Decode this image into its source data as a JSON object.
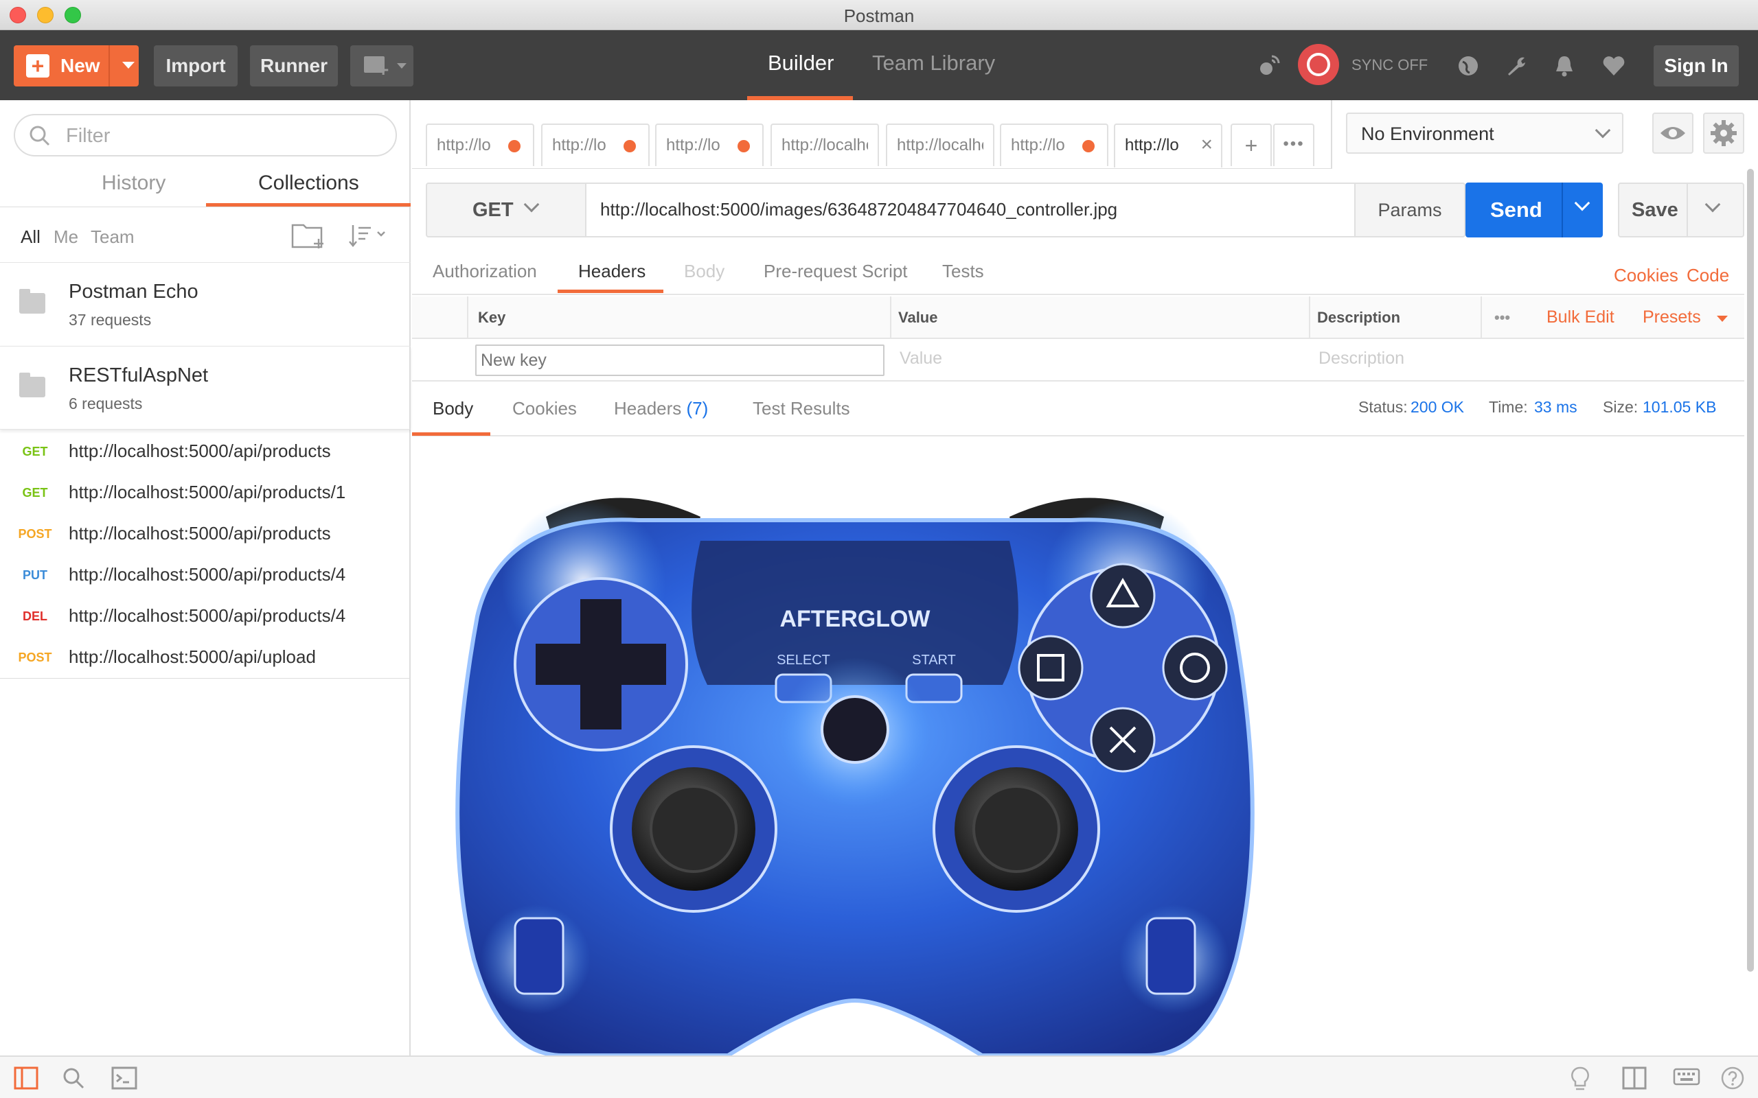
{
  "window": {
    "title": "Postman"
  },
  "header": {
    "new_label": "New",
    "import_label": "Import",
    "runner_label": "Runner",
    "nav": [
      {
        "label": "Builder"
      },
      {
        "label": "Team Library"
      }
    ],
    "sync_text": "SYNC OFF",
    "signin_label": "Sign In",
    "accent": "#f26b3a"
  },
  "sidebar": {
    "filter_placeholder": "Filter",
    "tabs": [
      {
        "label": "History"
      },
      {
        "label": "Collections"
      }
    ],
    "scopes": [
      "All",
      "Me",
      "Team"
    ],
    "collections": [
      {
        "name": "Postman Echo",
        "count": "37 requests"
      },
      {
        "name": "RESTfulAspNet",
        "count": "6 requests"
      }
    ],
    "requests": [
      {
        "method": "GET",
        "color": "#79c314",
        "url": "http://localhost:5000/api/products"
      },
      {
        "method": "GET",
        "color": "#79c314",
        "url": "http://localhost:5000/api/products/1"
      },
      {
        "method": "POST",
        "color": "#f5a623",
        "url": "http://localhost:5000/api/products"
      },
      {
        "method": "PUT",
        "color": "#3a8bd8",
        "url": "http://localhost:5000/api/products/4"
      },
      {
        "method": "DEL",
        "color": "#e0302c",
        "url": "http://localhost:5000/api/products/4"
      },
      {
        "method": "POST",
        "color": "#f5a623",
        "url": "http://localhost:5000/api/upload"
      }
    ]
  },
  "tabs": [
    {
      "label": "http://lo",
      "unsaved": true
    },
    {
      "label": "http://lo",
      "unsaved": true
    },
    {
      "label": "http://lo",
      "unsaved": true
    },
    {
      "label": "http://localho",
      "unsaved": false
    },
    {
      "label": "http://localhos",
      "unsaved": false
    },
    {
      "label": "http://lo",
      "unsaved": true
    },
    {
      "label": "http://lo",
      "unsaved": false,
      "active": true
    }
  ],
  "environment": {
    "selected": "No Environment"
  },
  "request": {
    "method": "GET",
    "url": "http://localhost:5000/images/636487204847704640_controller.jpg",
    "params_label": "Params",
    "send_label": "Send",
    "save_label": "Save",
    "tabs": [
      "Authorization",
      "Headers",
      "Body",
      "Pre-request Script",
      "Tests"
    ],
    "active_tab": "Headers",
    "links": {
      "cookies": "Cookies",
      "code": "Code"
    },
    "headers_table": {
      "columns": [
        "Key",
        "Value",
        "Description"
      ],
      "bulk_edit": "Bulk Edit",
      "presets": "Presets",
      "more": "•••",
      "placeholders": {
        "key": "New key",
        "value": "Value",
        "description": "Description"
      }
    }
  },
  "response": {
    "tabs": [
      "Body",
      "Cookies",
      "Headers",
      "Test Results"
    ],
    "headers_count": "(7)",
    "status_label": "Status:",
    "status": "200 OK",
    "time_label": "Time:",
    "time": "33 ms",
    "size_label": "Size:",
    "size": "101.05 KB",
    "image_logo": "AFTERGLOW",
    "image_select": "SELECT",
    "image_start": "START"
  }
}
